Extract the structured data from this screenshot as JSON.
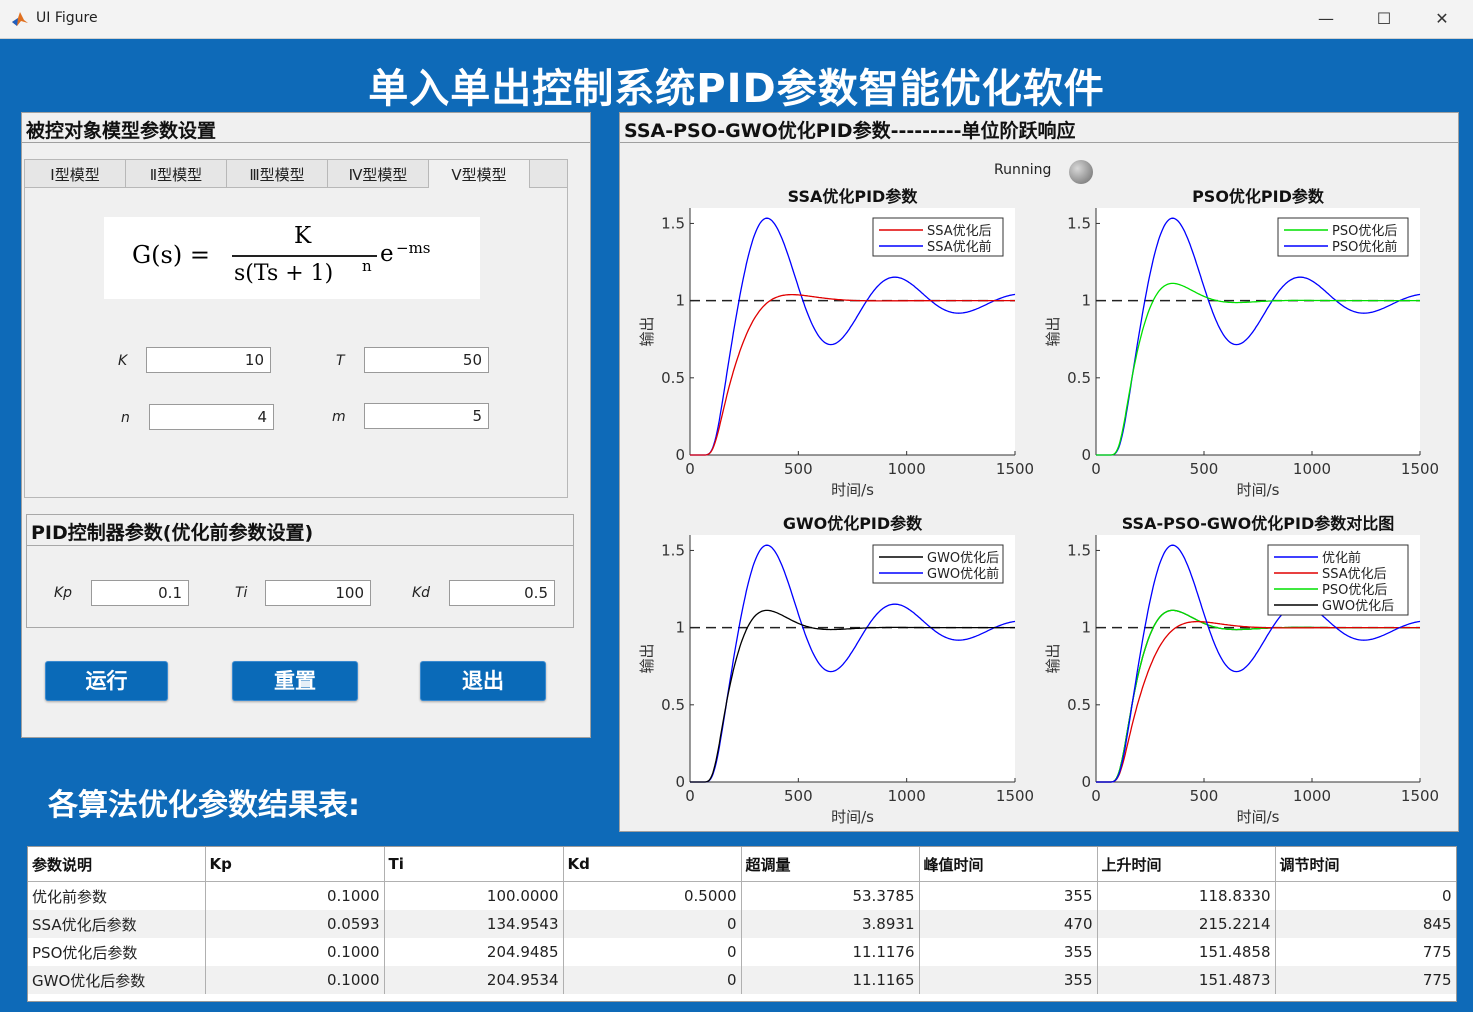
{
  "window": {
    "title": "UI Figure",
    "minimize": "—",
    "maximize": "☐",
    "close": "✕"
  },
  "app_title": "单入单出控制系统PID参数智能优化软件",
  "model_panel": {
    "title": "被控对象模型参数设置",
    "tabs": [
      "Ⅰ型模型",
      "Ⅱ型模型",
      "Ⅲ型模型",
      "Ⅳ型模型",
      "Ⅴ型模型"
    ],
    "active_tab": 4,
    "formula": {
      "lhs": "G(s) =",
      "num": "K",
      "den": "s(Ts + 1)",
      "den_exp": "n",
      "exp": "−ms"
    },
    "params": [
      {
        "label": "K",
        "value": "10"
      },
      {
        "label": "T",
        "value": "50"
      },
      {
        "label": "n",
        "value": "4"
      },
      {
        "label": "m",
        "value": "5"
      }
    ]
  },
  "pid_panel": {
    "title": "PID控制器参数(优化前参数设置)",
    "params": [
      {
        "label": "Kp",
        "value": "0.1"
      },
      {
        "label": "Ti",
        "value": "100"
      },
      {
        "label": "Kd",
        "value": "0.5"
      }
    ]
  },
  "buttons": {
    "run": "运行",
    "reset": "重置",
    "exit": "退出"
  },
  "plot_panel": {
    "title": "SSA-PSO-GWO优化PID参数---------单位阶跃响应",
    "status": "Running"
  },
  "results_title": "各算法优化参数结果表:",
  "results_table": {
    "headers": [
      "参数说明",
      "Kp",
      "Ti",
      "Kd",
      "超调量",
      "峰值时间",
      "上升时间",
      "调节时间"
    ],
    "rows": [
      [
        "优化前参数",
        "0.1000",
        "100.0000",
        "0.5000",
        "53.3785",
        "355",
        "118.8330",
        "0"
      ],
      [
        "SSA优化后参数",
        "0.0593",
        "134.9543",
        "0",
        "3.8931",
        "470",
        "215.2214",
        "845"
      ],
      [
        "PSO优化后参数",
        "0.1000",
        "204.9485",
        "0",
        "11.1176",
        "355",
        "151.4858",
        "775"
      ],
      [
        "GWO优化后参数",
        "0.1000",
        "204.9534",
        "0",
        "11.1165",
        "355",
        "151.4873",
        "775"
      ]
    ]
  },
  "colors": {
    "background": "#0e6ab8",
    "before": "#0000ff",
    "ssa": "#e00000",
    "pso": "#00e000",
    "gwo": "#000000"
  },
  "chart_data": [
    {
      "type": "line",
      "title": "SSA优化PID参数",
      "xlabel": "时间/s",
      "ylabel": "输出",
      "xlim": [
        0,
        1500
      ],
      "ylim": [
        0,
        1.6
      ],
      "xticks": [
        "0",
        "500",
        "1000",
        "1500"
      ],
      "yticks": [
        "0",
        "0.5",
        "1",
        "1.5"
      ],
      "legend": "top-right",
      "series": [
        {
          "name": "SSA优化后",
          "color": "#e00000",
          "overshoot": 0.0389,
          "peak_time": 470,
          "rise_time": 215
        },
        {
          "name": "SSA优化前",
          "color": "#0000ff",
          "overshoot": 0.5338,
          "peak_time": 355,
          "rise_time": 119
        }
      ],
      "reference": 1
    },
    {
      "type": "line",
      "title": "PSO优化PID参数",
      "xlabel": "时间/s",
      "ylabel": "输出",
      "xlim": [
        0,
        1500
      ],
      "ylim": [
        0,
        1.6
      ],
      "xticks": [
        "0",
        "500",
        "1000",
        "1500"
      ],
      "yticks": [
        "0",
        "0.5",
        "1",
        "1.5"
      ],
      "legend": "top-right",
      "series": [
        {
          "name": "PSO优化后",
          "color": "#00e000",
          "overshoot": 0.1118,
          "peak_time": 355,
          "rise_time": 151
        },
        {
          "name": "PSO优化前",
          "color": "#0000ff",
          "overshoot": 0.5338,
          "peak_time": 355,
          "rise_time": 119
        }
      ],
      "reference": 1
    },
    {
      "type": "line",
      "title": "GWO优化PID参数",
      "xlabel": "时间/s",
      "ylabel": "输出",
      "xlim": [
        0,
        1500
      ],
      "ylim": [
        0,
        1.6
      ],
      "xticks": [
        "0",
        "500",
        "1000",
        "1500"
      ],
      "yticks": [
        "0",
        "0.5",
        "1",
        "1.5"
      ],
      "legend": "top-right",
      "series": [
        {
          "name": "GWO优化后",
          "color": "#000000",
          "overshoot": 0.1117,
          "peak_time": 355,
          "rise_time": 151
        },
        {
          "name": "GWO优化前",
          "color": "#0000ff",
          "overshoot": 0.5338,
          "peak_time": 355,
          "rise_time": 119
        }
      ],
      "reference": 1
    },
    {
      "type": "line",
      "title": "SSA-PSO-GWO优化PID参数对比图",
      "xlabel": "时间/s",
      "ylabel": "输出",
      "xlim": [
        0,
        1500
      ],
      "ylim": [
        0,
        1.6
      ],
      "xticks": [
        "0",
        "500",
        "1000",
        "1500"
      ],
      "yticks": [
        "0",
        "0.5",
        "1",
        "1.5"
      ],
      "legend": "top-right",
      "series": [
        {
          "name": "优化前",
          "color": "#0000ff",
          "overshoot": 0.5338,
          "peak_time": 355,
          "rise_time": 119
        },
        {
          "name": "SSA优化后",
          "color": "#e00000",
          "overshoot": 0.0389,
          "peak_time": 470,
          "rise_time": 215
        },
        {
          "name": "PSO优化后",
          "color": "#00e000",
          "overshoot": 0.1118,
          "peak_time": 355,
          "rise_time": 151
        },
        {
          "name": "GWO优化后",
          "color": "#000000",
          "overshoot": 0.1117,
          "peak_time": 355,
          "rise_time": 151
        }
      ],
      "reference": 1
    }
  ]
}
